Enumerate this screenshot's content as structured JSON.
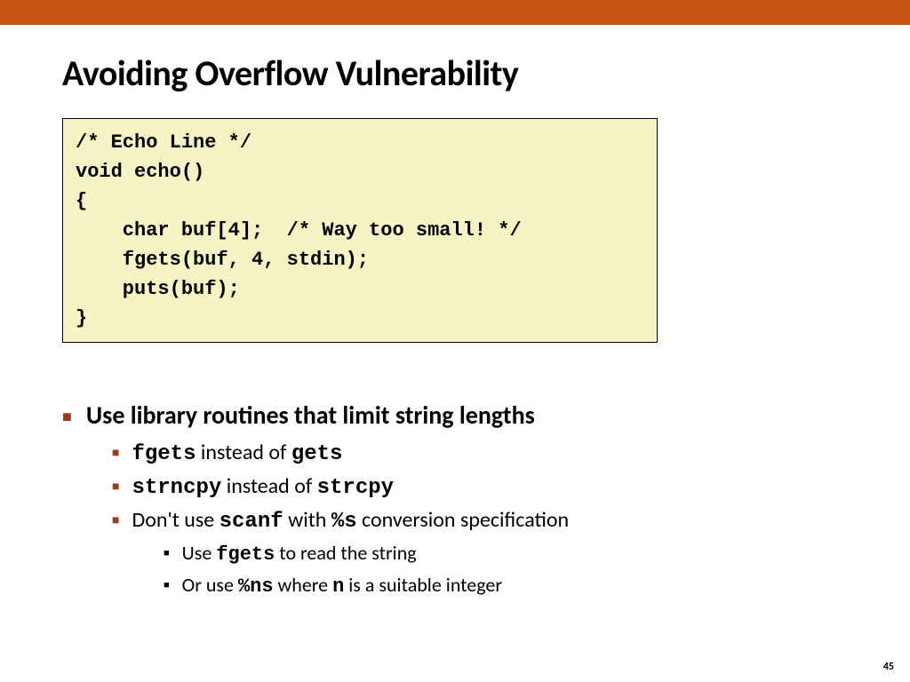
{
  "title": "Avoiding Overflow Vulnerability",
  "code": "/* Echo Line */\nvoid echo()\n{\n    char buf[4];  /* Way too small! */\n    fgets(buf, 4, stdin);\n    puts(buf);\n}",
  "bullets": {
    "lvl1": "Use library routines that limit string lengths",
    "lvl2a_code1": "fgets",
    "lvl2a_mid": " instead of ",
    "lvl2a_code2": "gets",
    "lvl2b_code1": "strncpy",
    "lvl2b_mid": " instead of ",
    "lvl2b_code2": "strcpy",
    "lvl2c_pre": "Don't use ",
    "lvl2c_code1": "scanf",
    "lvl2c_mid": " with ",
    "lvl2c_code2": "%s",
    "lvl2c_post": " conversion specification",
    "lvl3a_pre": "Use ",
    "lvl3a_code": "fgets",
    "lvl3a_post": " to read the string",
    "lvl3b_pre": "Or use ",
    "lvl3b_code1": "%ns",
    "lvl3b_mid": "  where ",
    "lvl3b_code2": "n",
    "lvl3b_post": " is a suitable integer"
  },
  "page_number": "45"
}
